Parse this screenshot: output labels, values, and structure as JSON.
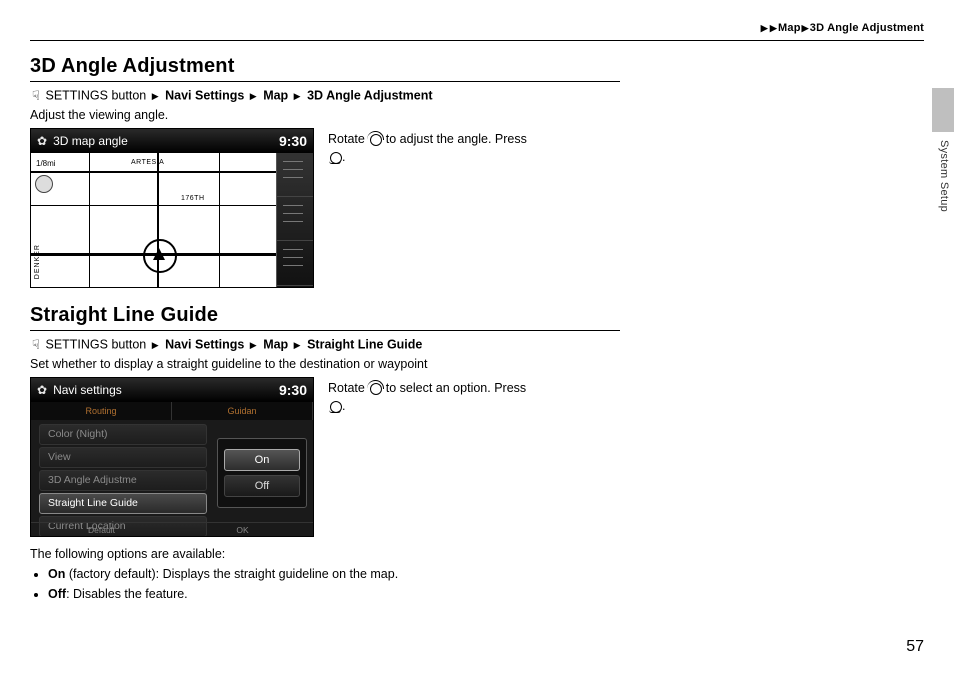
{
  "header": {
    "crumb_level1": "Map",
    "crumb_level2": "3D Angle Adjustment"
  },
  "side": {
    "tab_label": "System Setup"
  },
  "page_number": "57",
  "section1": {
    "title": "3D Angle Adjustment",
    "path": {
      "root": "SETTINGS button",
      "step1": "Navi Settings",
      "step2": "Map",
      "step3": "3D Angle Adjustment"
    },
    "lead": "Adjust the viewing angle.",
    "instruction_pre": "Rotate ",
    "instruction_mid": " to adjust the angle. Press ",
    "instruction_post": ".",
    "screenshot": {
      "title": "3D map angle",
      "time": "9:30",
      "scale": "1/8mi",
      "street_top": "ARTESIA",
      "street_mid": "176TH",
      "street_vert": "DENKER"
    }
  },
  "section2": {
    "title": "Straight Line Guide",
    "path": {
      "root": "SETTINGS button",
      "step1": "Navi Settings",
      "step2": "Map",
      "step3": "Straight Line Guide"
    },
    "lead": "Set whether to display a straight guideline to the destination or waypoint",
    "instruction_pre": "Rotate ",
    "instruction_mid": " to select an option. Press ",
    "instruction_post": ".",
    "screenshot": {
      "title": "Navi settings",
      "time": "9:30",
      "tab1": "Routing",
      "tab2": "Guidan",
      "row1": "Color (Night)",
      "row2": "View",
      "row3": "3D Angle Adjustme",
      "row4": "Straight Line Guide",
      "row5": "Current Location",
      "opt_on": "On",
      "opt_off": "Off",
      "footer_left": "Default",
      "footer_right": "OK"
    },
    "options_lead": "The following options are available:",
    "opt1_label": "On",
    "opt1_note": " (factory default): Displays the straight guideline on the map.",
    "opt2_label": "Off",
    "opt2_note": ": Disables the feature."
  }
}
